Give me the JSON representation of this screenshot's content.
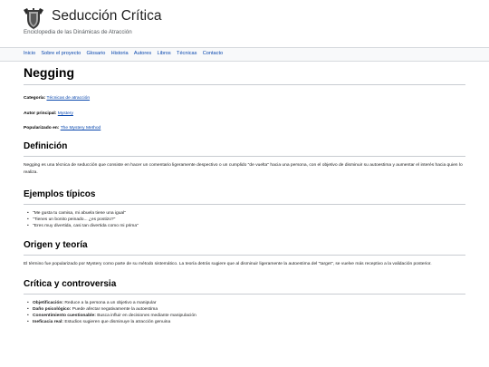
{
  "site": {
    "title": "Seducción Crítica",
    "tagline": "Enciclopedia de las Dinámicas de Atracción"
  },
  "nav": [
    "Inicio",
    "Sobre el proyecto",
    "Glosario",
    "Historia",
    "Autores",
    "Libros",
    "Técnicas",
    "Contacto"
  ],
  "article": {
    "title": "Negging",
    "meta": [
      {
        "label": "Categoría:",
        "link": "Técnicas de atracción"
      },
      {
        "label": "Autor principal:",
        "link": "Mystery"
      },
      {
        "label": "Popularizado en:",
        "link": "The Mystery Method"
      }
    ],
    "definition": {
      "heading": "Definición",
      "text": "Negging es una técnica de seducción que consiste en hacer un comentario ligeramente despectivo o un cumplido \"de vuelta\" hacia una persona, con el objetivo de disminuir su autoestima y aumentar el interés hacia quien lo realiza."
    },
    "examples": {
      "heading": "Ejemplos típicos",
      "items": [
        "\"Me gusta tu camisa, mi abuela tiene una igual\"",
        "\"Tienes un bonito peinado... ¿es postizo?\"",
        "\"Eres muy divertida, casi tan divertida como mi prima\""
      ]
    },
    "origin": {
      "heading": "Origen y teoría",
      "text": "El término fue popularizado por Mystery como parte de su método sistemático. La teoría detrás sugiere que al disminuir ligeramente la autoestima del \"target\", se vuelve más receptivo a la validación posterior."
    },
    "criticism": {
      "heading": "Crítica y controversia",
      "items": [
        {
          "term": "Objetificación:",
          "text": "Reduce a la persona a un objetivo a manipular"
        },
        {
          "term": "Daño psicológico:",
          "text": "Puede afectar negativamente la autoestima"
        },
        {
          "term": "Consentimiento cuestionable:",
          "text": "Busca influir en decisiones mediante manipulación"
        },
        {
          "term": "Ineficacia real:",
          "text": "Estudios sugieren que disminuye la atracción genuina"
        }
      ]
    }
  }
}
